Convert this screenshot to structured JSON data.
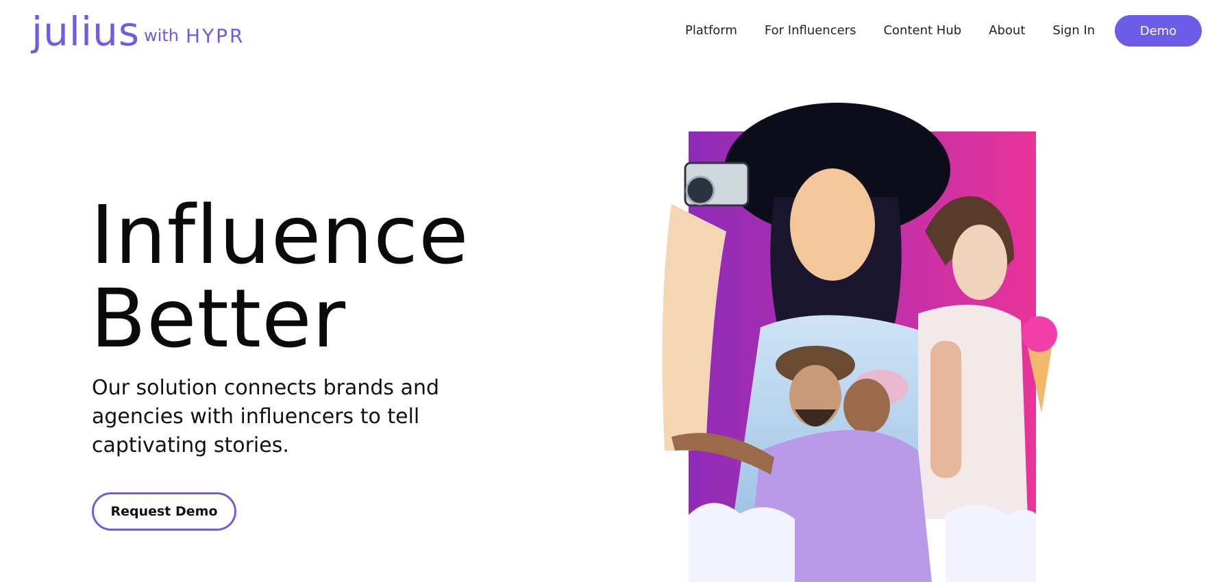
{
  "header": {
    "logo": {
      "name": "julius",
      "with": "with",
      "partner": "HYPR"
    },
    "nav": {
      "items": [
        {
          "label": "Platform"
        },
        {
          "label": "For Influencers"
        },
        {
          "label": "Content Hub"
        },
        {
          "label": "About"
        },
        {
          "label": "Sign In"
        }
      ]
    },
    "demo_label": "Demo"
  },
  "hero": {
    "title_line1": "Influence",
    "title_line2": "Better",
    "subtitle": "Our solution connects brands and agencies with influencers to tell captivating stories.",
    "cta_label": "Request Demo"
  },
  "colors": {
    "brand_purple": "#6c5ce7",
    "background": "#ffffff",
    "text": "#111111",
    "image_panel_start": "#8e2bb8",
    "image_panel_end": "#e8339a"
  }
}
